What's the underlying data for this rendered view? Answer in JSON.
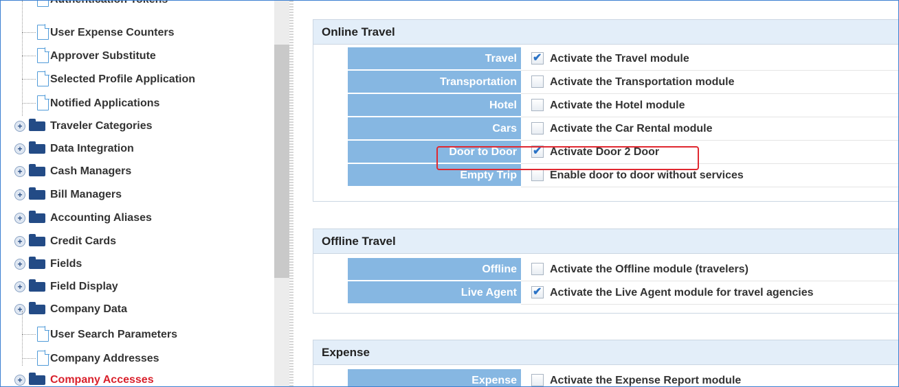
{
  "tree": {
    "top_partial_label": "Authentication Tokens",
    "items": [
      {
        "label": "User Expense Counters",
        "type": "leaf"
      },
      {
        "label": "Approver Substitute",
        "type": "leaf"
      },
      {
        "label": "Selected Profile Application",
        "type": "leaf"
      },
      {
        "label": "Notified Applications",
        "type": "leaf"
      },
      {
        "label": "Traveler Categories",
        "type": "folder"
      },
      {
        "label": "Data Integration",
        "type": "folder"
      },
      {
        "label": "Cash Managers",
        "type": "folder"
      },
      {
        "label": "Bill Managers",
        "type": "folder"
      },
      {
        "label": "Accounting Aliases",
        "type": "folder"
      },
      {
        "label": "Credit Cards",
        "type": "folder"
      },
      {
        "label": "Fields",
        "type": "folder"
      },
      {
        "label": "Field Display",
        "type": "folder"
      },
      {
        "label": "Company Data",
        "type": "folder"
      },
      {
        "label": "User Search Parameters",
        "type": "leaf"
      },
      {
        "label": "Company Addresses",
        "type": "leaf"
      },
      {
        "label": "Company Accesses",
        "type": "folder",
        "selected": true
      }
    ]
  },
  "online_travel": {
    "title": "Online Travel",
    "rows": [
      {
        "label": "Travel",
        "text": "Activate the Travel module",
        "checked": true
      },
      {
        "label": "Transportation",
        "text": "Activate the Transportation module",
        "checked": false
      },
      {
        "label": "Hotel",
        "text": "Activate the Hotel module",
        "checked": false
      },
      {
        "label": "Cars",
        "text": "Activate the Car Rental module",
        "checked": false
      },
      {
        "label": "Door to Door",
        "text": "Activate Door 2 Door",
        "checked": true
      },
      {
        "label": "Empty Trip",
        "text": "Enable door to door without services",
        "checked": false
      }
    ]
  },
  "offline_travel": {
    "title": "Offline Travel",
    "rows": [
      {
        "label": "Offline",
        "text": "Activate the Offline module (travelers)",
        "checked": false
      },
      {
        "label": "Live Agent",
        "text": "Activate the Live Agent module for travel agencies",
        "checked": true
      }
    ]
  },
  "expense": {
    "title": "Expense",
    "rows": [
      {
        "label": "Expense",
        "text": "Activate the Expense Report module",
        "checked": false
      }
    ]
  },
  "colors": {
    "label_bg": "#86b7e2",
    "header_bg": "#e3eef9",
    "highlight": "#e0272f",
    "selected_text": "#d9202b"
  }
}
